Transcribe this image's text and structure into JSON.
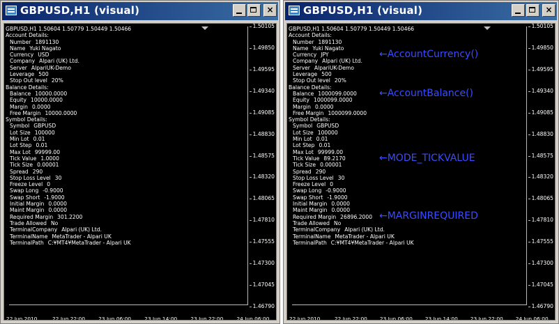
{
  "windows": [
    {
      "title": "GBPUSD,H1  (visual)",
      "header_line": "GBPUSD,H1  1.50604 1.50779 1.50449 1.50466",
      "rows": [
        {
          "k": "Account Details:",
          "v": "",
          "ind": false
        },
        {
          "k": "Number",
          "v": "1891130",
          "ind": true
        },
        {
          "k": "Name",
          "v": "Yuki Nagato",
          "ind": true
        },
        {
          "k": "Currency",
          "v": "USD",
          "ind": true
        },
        {
          "k": "Company",
          "v": "Alpari (UK) Ltd.",
          "ind": true
        },
        {
          "k": "Server",
          "v": "AlpariUK-Demo",
          "ind": true
        },
        {
          "k": "Leverage",
          "v": "500",
          "ind": true
        },
        {
          "k": "Stop Out level",
          "v": "20%",
          "ind": true
        },
        {
          "k": "Balance Details:",
          "v": "",
          "ind": false
        },
        {
          "k": "Balance",
          "v": "10000.0000",
          "ind": true
        },
        {
          "k": "Equity",
          "v": "10000.0000",
          "ind": true
        },
        {
          "k": "Margin",
          "v": "0.0000",
          "ind": true
        },
        {
          "k": "Free Margin",
          "v": "10000.0000",
          "ind": true
        },
        {
          "k": "Symbol Details:",
          "v": "",
          "ind": false
        },
        {
          "k": "Symbol",
          "v": "GBPUSD",
          "ind": true
        },
        {
          "k": "Lot Size",
          "v": "100000",
          "ind": true
        },
        {
          "k": "Min Lot",
          "v": "0.01",
          "ind": true
        },
        {
          "k": "Lot Step",
          "v": "0.01",
          "ind": true
        },
        {
          "k": "Max Lot",
          "v": "99999.00",
          "ind": true
        },
        {
          "k": "Tick Value",
          "v": "1.0000",
          "ind": true
        },
        {
          "k": "Tick Size",
          "v": "0.00001",
          "ind": true
        },
        {
          "k": "Spread",
          "v": "290",
          "ind": true
        },
        {
          "k": "Stop Loss Level",
          "v": "30",
          "ind": true
        },
        {
          "k": "Freeze Level",
          "v": "0",
          "ind": true
        },
        {
          "k": "Swap Long",
          "v": "-0.9000",
          "ind": true
        },
        {
          "k": "Swap Short",
          "v": "-1.9000",
          "ind": true
        },
        {
          "k": "Initial Margin",
          "v": "0.0000",
          "ind": true
        },
        {
          "k": "Maint Margin",
          "v": "0.0000",
          "ind": true
        },
        {
          "k": "Required Margin",
          "v": "301.2200",
          "ind": true
        },
        {
          "k": "Trade Allowed",
          "v": "No",
          "ind": true
        },
        {
          "k": "TerminalCompany",
          "v": "Alpari (UK) Ltd.",
          "ind": true
        },
        {
          "k": "TerminalName",
          "v": "MetaTrader - Alpari UK",
          "ind": true
        },
        {
          "k": "TerminalPath",
          "v": "C:¥MT4¥MetaTrader - Alpari UK",
          "ind": true
        }
      ],
      "prices": [
        "1.50105",
        "1.49850",
        "1.49595",
        "1.49340",
        "1.49085",
        "1.48830",
        "1.48575",
        "1.48320",
        "1.48065",
        "1.47810",
        "1.47555",
        "1.47300",
        "1.47045",
        "1.46790"
      ],
      "dates": [
        "22 Jun 2010",
        "22 Jun 22:00",
        "23 Jun 06:00",
        "23 Jun 14:00",
        "23 Jun 22:00",
        "24 Jun 06:00"
      ],
      "annotations": []
    },
    {
      "title": "GBPUSD,H1  (visual)",
      "header_line": "GBPUSD,H1  1.50604 1.50779 1.50449 1.50466",
      "rows": [
        {
          "k": "Account Details:",
          "v": "",
          "ind": false
        },
        {
          "k": "Number",
          "v": "1891130",
          "ind": true
        },
        {
          "k": "Name",
          "v": "Yuki Nagato",
          "ind": true
        },
        {
          "k": "Currency",
          "v": "JPY",
          "ind": true
        },
        {
          "k": "Company",
          "v": "Alpari (UK) Ltd.",
          "ind": true
        },
        {
          "k": "Server",
          "v": "AlpariUK-Demo",
          "ind": true
        },
        {
          "k": "Leverage",
          "v": "500",
          "ind": true
        },
        {
          "k": "Stop Out level",
          "v": "20%",
          "ind": true
        },
        {
          "k": "Balance Details:",
          "v": "",
          "ind": false
        },
        {
          "k": "Balance",
          "v": "1000099.0000",
          "ind": true
        },
        {
          "k": "Equity",
          "v": "1000099.0000",
          "ind": true
        },
        {
          "k": "Margin",
          "v": "0.0000",
          "ind": true
        },
        {
          "k": "Free Margin",
          "v": "1000099.0000",
          "ind": true
        },
        {
          "k": "Symbol Details:",
          "v": "",
          "ind": false
        },
        {
          "k": "Symbol",
          "v": "GBPUSD",
          "ind": true
        },
        {
          "k": "Lot Size",
          "v": "100000",
          "ind": true
        },
        {
          "k": "Min Lot",
          "v": "0.01",
          "ind": true
        },
        {
          "k": "Lot Step",
          "v": "0.01",
          "ind": true
        },
        {
          "k": "Max Lot",
          "v": "99999.00",
          "ind": true
        },
        {
          "k": "Tick Value",
          "v": "89.2170",
          "ind": true
        },
        {
          "k": "Tick Size",
          "v": "0.00001",
          "ind": true
        },
        {
          "k": "Spread",
          "v": "290",
          "ind": true
        },
        {
          "k": "Stop Loss Level",
          "v": "30",
          "ind": true
        },
        {
          "k": "Freeze Level",
          "v": "0",
          "ind": true
        },
        {
          "k": "Swap Long",
          "v": "-0.9000",
          "ind": true
        },
        {
          "k": "Swap Short",
          "v": "-1.9000",
          "ind": true
        },
        {
          "k": "Initial Margin",
          "v": "0.0000",
          "ind": true
        },
        {
          "k": "Maint Margin",
          "v": "0.0000",
          "ind": true
        },
        {
          "k": "Required Margin",
          "v": "26896.2000",
          "ind": true
        },
        {
          "k": "Trade Allowed",
          "v": "No",
          "ind": true
        },
        {
          "k": "TerminalCompany",
          "v": "Alpari (UK) Ltd.",
          "ind": true
        },
        {
          "k": "TerminalName",
          "v": "MetaTrader - Alpari UK",
          "ind": true
        },
        {
          "k": "TerminalPath",
          "v": "C:¥MT4¥MetaTrader - Alpari UK",
          "ind": true
        }
      ],
      "prices": [
        "1.50105",
        "1.49850",
        "1.49595",
        "1.49340",
        "1.49085",
        "1.48830",
        "1.48575",
        "1.48320",
        "1.48065",
        "1.47810",
        "1.47555",
        "1.47300",
        "1.47045",
        "1.46790"
      ],
      "dates": [
        "22 Jun 2010",
        "22 Jun 22:00",
        "23 Jun 06:00",
        "23 Jun 14:00",
        "23 Jun 22:00",
        "24 Jun 06:00"
      ],
      "annotations": [
        {
          "text": "←AccountCurrency()",
          "row": 3
        },
        {
          "text": "←AccountBalance()",
          "row": 9
        },
        {
          "text": "←MODE_TICKVALUE",
          "row": 19
        },
        {
          "text": "←MARGINREQUIRED",
          "row": 28
        }
      ]
    }
  ],
  "ui": {
    "minimize": "_",
    "maximize": "□",
    "close": "×",
    "annotation_color": "#3a4cff",
    "chart_background": "#000000",
    "title_bar_color": "#0a246a"
  }
}
